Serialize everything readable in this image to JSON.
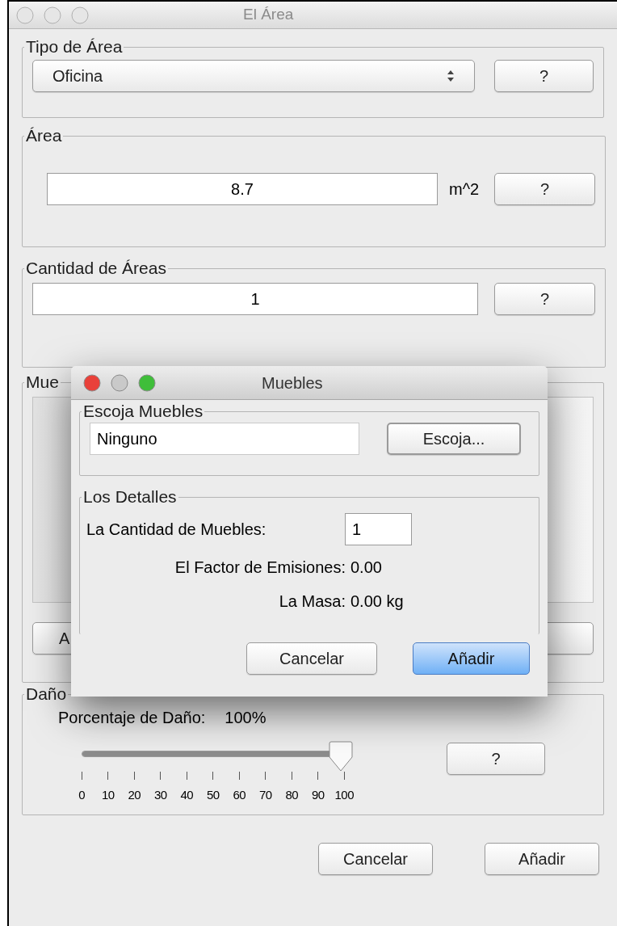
{
  "window": {
    "title": "El Área"
  },
  "tipo_de_area": {
    "title": "Tipo de Área",
    "value": "Oficina",
    "help": "?"
  },
  "area": {
    "title": "Área",
    "value": "8.7",
    "unit": "m^2",
    "help": "?"
  },
  "cantidad": {
    "title": "Cantidad de Áreas",
    "value": "1",
    "help": "?"
  },
  "muebles": {
    "title": "Mue",
    "button_1": "A"
  },
  "dano": {
    "title": "Daño",
    "label": "Porcentaje de Daño:",
    "reading": "100%",
    "level": 1,
    "tick_labels": [
      "0",
      "10",
      "20",
      "30",
      "40",
      "50",
      "60",
      "70",
      "80",
      "90",
      "100"
    ],
    "help": "?"
  },
  "buttons": [
    "Cancelar",
    "Añadir"
  ],
  "dialog": {
    "title": "Muebles",
    "escoja": {
      "title": "Escoja Muebles",
      "value": "Ninguno",
      "button": "Escoja..."
    },
    "detalles": {
      "title": "Los Detalles",
      "cantidad_label": "La Cantidad de Muebles:",
      "cantidad_value": "1",
      "rows": [
        {
          "label": "El Factor de Emisiones:",
          "value": "0.00"
        },
        {
          "label": "La Masa:",
          "value": "0.00 kg"
        }
      ]
    },
    "buttons": [
      {
        "label": "Cancelar",
        "default": false
      },
      {
        "label": "Añadir",
        "default": true
      }
    ]
  }
}
